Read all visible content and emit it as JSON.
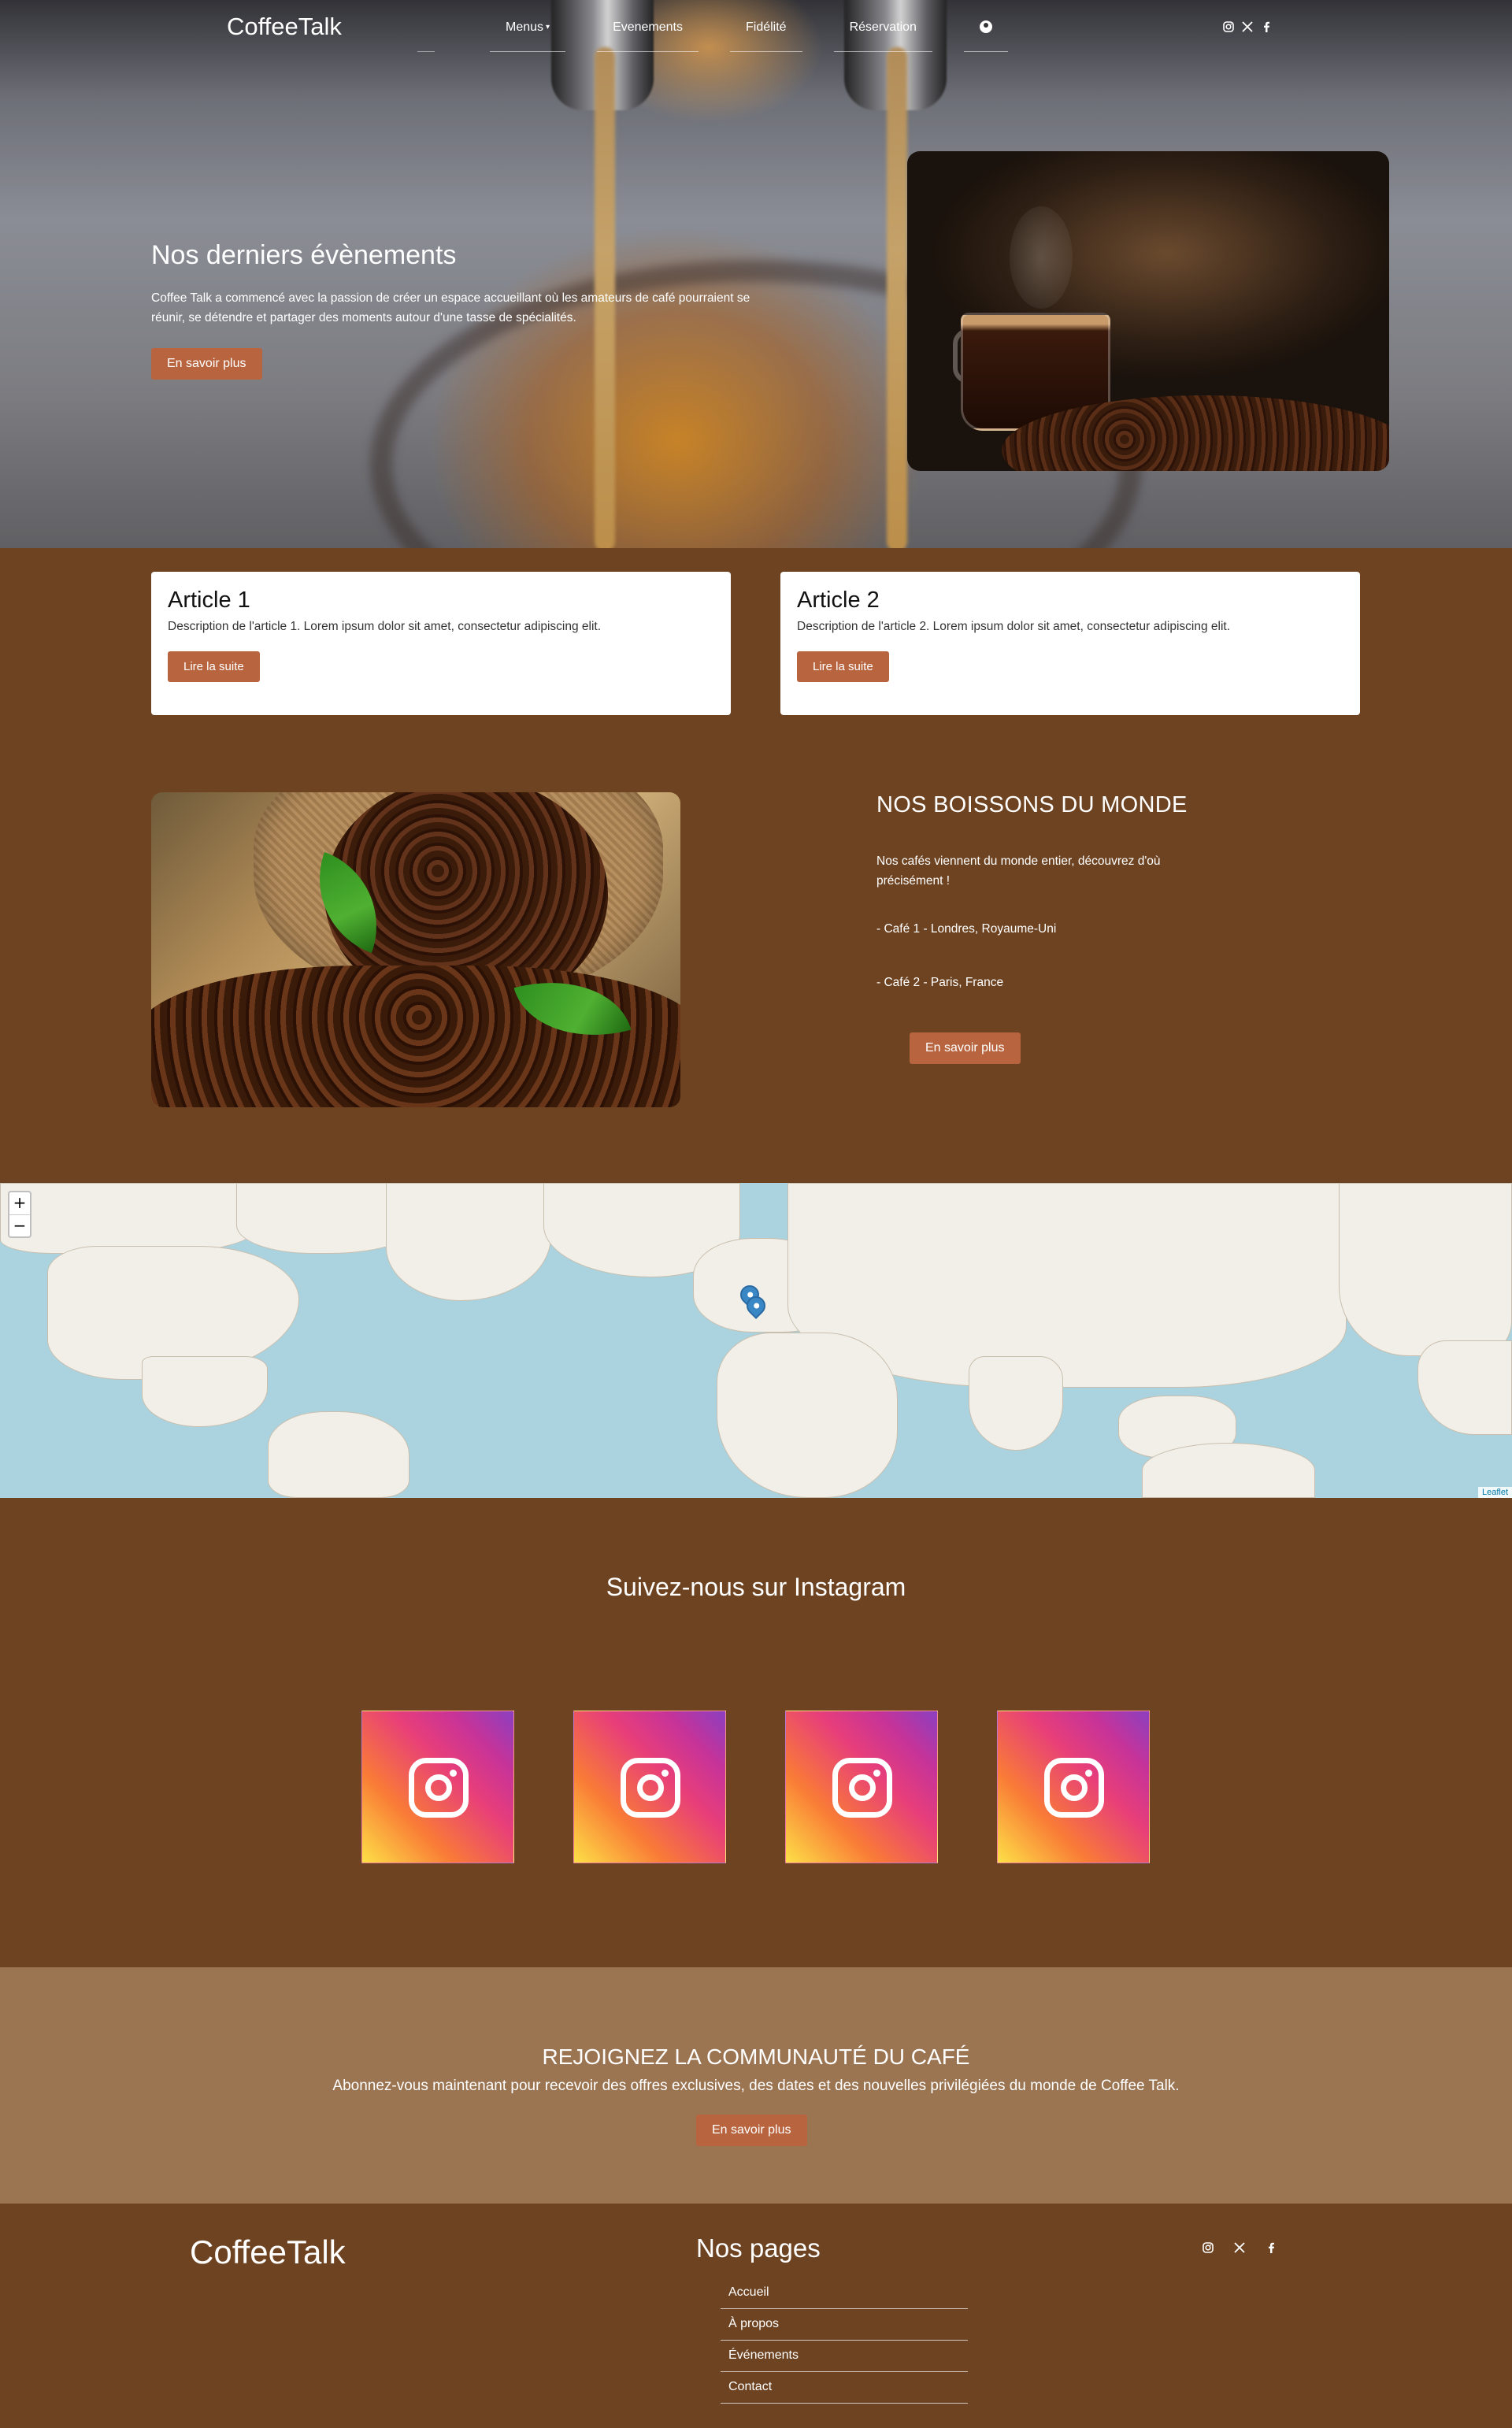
{
  "nav": {
    "brand": "CoffeeTalk",
    "items": [
      {
        "label": "Menus"
      },
      {
        "label": "Evenements"
      },
      {
        "label": "Fidélité"
      },
      {
        "label": "Réservation"
      }
    ],
    "user_icon": "user-circle-icon",
    "socials": [
      "instagram-icon",
      "x-icon",
      "facebook-icon"
    ]
  },
  "hero": {
    "title": "Nos derniers évènements",
    "description": "Coffee Talk a commencé avec la passion de créer un espace accueillant où les amateurs de café pourraient se réunir, se détendre et partager des moments autour d'une tasse de spécialités.",
    "button": "En savoir plus"
  },
  "articles": [
    {
      "title": "Article 1",
      "description": "Description de l'article 1. Lorem ipsum dolor sit amet, consectetur adipiscing elit.",
      "button": "Lire la suite"
    },
    {
      "title": "Article 2",
      "description": "Description de l'article 2. Lorem ipsum dolor sit amet, consectetur adipiscing elit.",
      "button": "Lire la suite"
    }
  ],
  "drinks": {
    "title": "NOS BOISSONS DU MONDE",
    "description": "Nos cafés viennent du monde entier, découvrez d'où précisément !",
    "items": [
      "- Café 1 - Londres, Royaume-Uni",
      "- Café 2 - Paris, France"
    ],
    "button": "En savoir plus"
  },
  "map": {
    "zoom_in": "+",
    "zoom_out": "−",
    "attribution": "Leaflet",
    "markers": [
      "Londres",
      "Paris"
    ]
  },
  "instagram": {
    "title": "Suivez-nous sur Instagram",
    "tile_count": 4
  },
  "cta": {
    "title": "REJOIGNEZ LA COMMUNAUTÉ DU CAFÉ",
    "description": "Abonnez-vous maintenant pour recevoir des offres exclusives, des dates et des nouvelles privilégiées du monde de Coffee Talk.",
    "button": "En savoir plus"
  },
  "footer": {
    "brand": "CoffeeTalk",
    "pages_title": "Nos pages",
    "links": [
      "Accueil",
      "À propos",
      "Événements",
      "Contact"
    ],
    "socials": [
      "instagram-icon",
      "x-icon",
      "facebook-icon"
    ]
  },
  "colors": {
    "page_brown": "#6e4321",
    "accent_button": "#b8653f",
    "cta_background": "#9b7452",
    "map_water": "#aad3df",
    "map_land": "#f2efe9"
  }
}
